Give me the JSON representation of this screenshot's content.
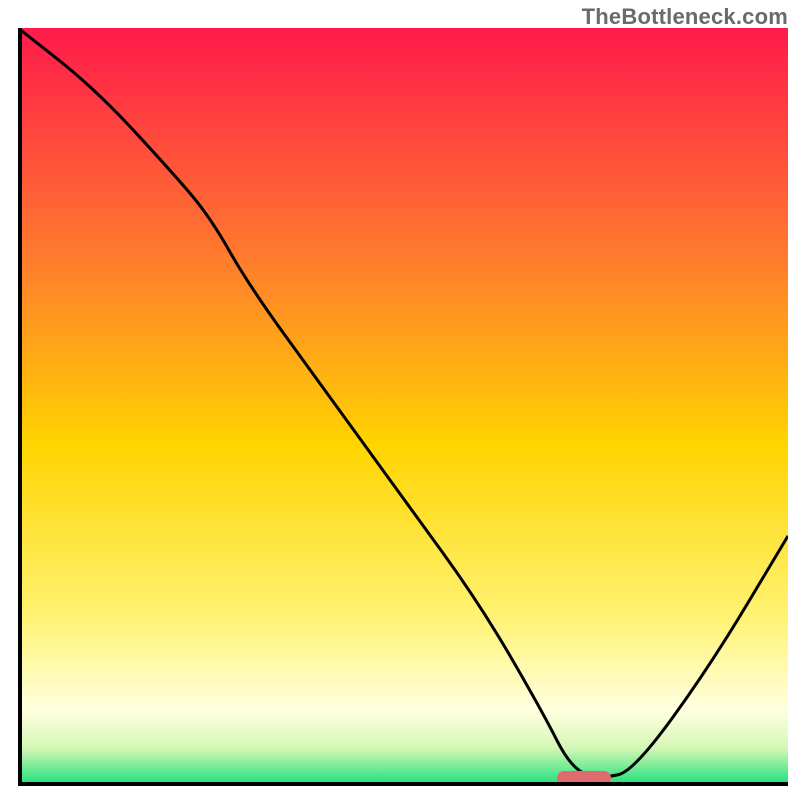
{
  "watermark": "TheBottleneck.com",
  "colors": {
    "grad_top": "#ff1a4b",
    "grad_mid1": "#ff7a2e",
    "grad_mid2": "#ffd400",
    "grad_mid3": "#fff375",
    "grad_mid4": "#ffffe0",
    "grad_low1": "#d5f7b5",
    "grad_bottom": "#17e07a",
    "curve": "#000000",
    "marker": "#e16a6f"
  },
  "chart_data": {
    "type": "line",
    "title": "",
    "xlabel": "",
    "ylabel": "",
    "xlim": [
      0,
      100
    ],
    "ylim": [
      0,
      100
    ],
    "grid": false,
    "legend": false,
    "annotations": [
      "TheBottleneck.com"
    ],
    "x": [
      0,
      10,
      20,
      25,
      30,
      40,
      50,
      60,
      68,
      72,
      76,
      80,
      90,
      100
    ],
    "values": [
      100,
      92,
      81,
      75,
      66,
      52,
      38,
      24,
      10,
      2,
      1,
      2,
      16,
      33
    ],
    "optimal_range_x": [
      70,
      77
    ],
    "optimal_value": 1
  }
}
